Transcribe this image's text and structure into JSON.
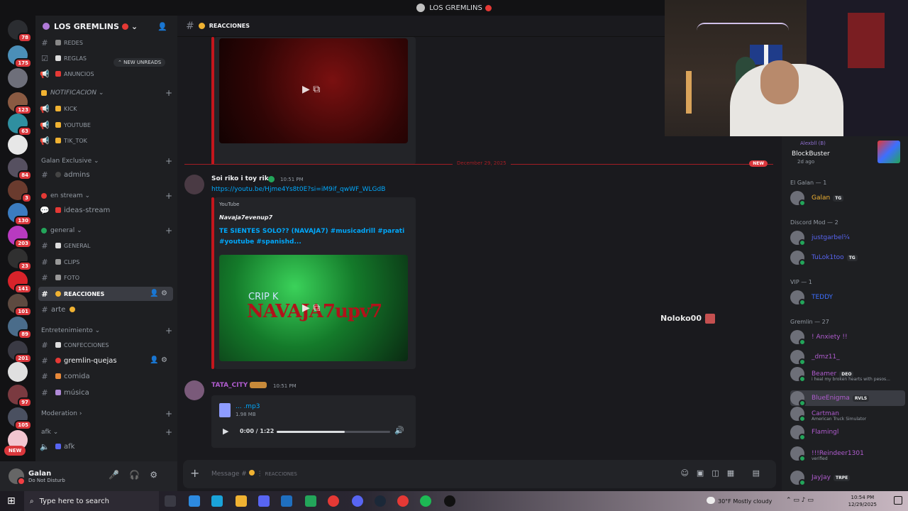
{
  "window_title": "LOS GREMLINS",
  "server": {
    "name": "LOS GREMLINS"
  },
  "rail_badges": [
    "78",
    "175",
    "",
    "",
    "123",
    "63",
    "",
    "84",
    "3",
    "130",
    "203",
    "23",
    "141",
    "101",
    "89",
    "201",
    "",
    "97",
    "105"
  ],
  "rail_new": "NEW",
  "new_unreads": "NEW UNREADS",
  "channels": {
    "redes": "REDES",
    "reglas": "REGLAS",
    "anuncios": "ANUNCIOS",
    "cat_notificacion": "NOTIFICACION",
    "kick": "KICK",
    "youtube": "YOUTUBE",
    "tiktok": "TIK_TOK",
    "cat_galan": "Galan Exclusive",
    "admins": "admins",
    "cat_stream": "en stream",
    "ideas": "ideas-stream",
    "cat_general": "general",
    "general": "GENERAL",
    "clips": "CLIPS",
    "foto": "FOTO",
    "reacciones": "REACCIONES",
    "arte": "arte",
    "cat_entre": "Entretenimiento",
    "confesiones": "CONFECCIONES",
    "quejas": "gremlin-quejas",
    "comida": "comida",
    "musica": "música",
    "cat_moderation": "Moderation",
    "cat_afk": "afk",
    "afk": "afk"
  },
  "user": {
    "name": "Galan",
    "status": "Do Not Disturb"
  },
  "main": {
    "channel": "REACCIONES",
    "divider_date": "December 29, 2025",
    "divider_new": "NEW",
    "msg1": {
      "user": "Soi riko i toy riko",
      "time": "10:51 PM",
      "link": "https://youtu.be/Hjme4Ys8t0E?si=iM9if_qwWF_WLGdB",
      "provider": "YouTube",
      "author": "Navaja7evenup7",
      "title": "TE SIENTES SOLO?? (NAVAJA7) #musicadrill #parati #youtube #spanishd...",
      "thumb_text1": "CRIP K",
      "thumb_text2": "NAVAJA7upv7"
    },
    "msg2": {
      "user": "TATA_CITY",
      "time": "10:51 PM",
      "file": "... .mp3",
      "size": "1.98 MB",
      "audio_time": "0:00 / 1:22",
      "progress": 0.6
    },
    "overlay": "Noloko00 :",
    "composer_placeholder": "Message #",
    "composer_channel": "REACCIONES"
  },
  "members": {
    "activity_user": "Alexbll (B)",
    "activity_name": "BlockBuster",
    "activity_time": "2d ago",
    "groups": [
      {
        "title": "El Galan",
        "count": "— 1"
      },
      {
        "title": "Discord Mod — 2"
      },
      {
        "title": "VIP",
        "count": "— 1"
      },
      {
        "title": "Gremlin",
        "count": "— 27"
      }
    ],
    "list": [
      {
        "name": "Galan",
        "tag": "TG",
        "color": "#f0b232"
      },
      {
        "name": "justgarbel¼",
        "tag": "",
        "color": "#5865f2"
      },
      {
        "name": "TuLok1too",
        "tag": "TG",
        "color": "#5865f2"
      },
      {
        "name": "TEDDY",
        "tag": "",
        "color": "#3d6fff"
      },
      {
        "name": "! Anxiety !!",
        "tag": "",
        "color": "#b05ccf"
      },
      {
        "name": "_dmz11_",
        "tag": "",
        "color": "#b05ccf"
      },
      {
        "name": "Beamer",
        "tag": "DEO",
        "color": "#b05ccf",
        "sub": "i heal my broken hearts with pesos..."
      },
      {
        "name": "BlueEnigma",
        "tag": "RVLS",
        "color": "#b05ccf"
      },
      {
        "name": "Cartman",
        "tag": "",
        "color": "#b05ccf",
        "sub": "American Truck Simulator"
      },
      {
        "name": "Flamingl",
        "tag": "",
        "color": "#b05ccf"
      },
      {
        "name": "!!!Reindeer1301",
        "tag": "",
        "color": "#b05ccf",
        "sub": "verified"
      },
      {
        "name": "JayJay",
        "tag": "TRPE",
        "color": "#b05ccf"
      }
    ]
  },
  "taskbar": {
    "search": "Type here to search",
    "weather": "30°F  Mostly cloudy",
    "time": "10:54 PM",
    "date": "12/29/2025"
  }
}
